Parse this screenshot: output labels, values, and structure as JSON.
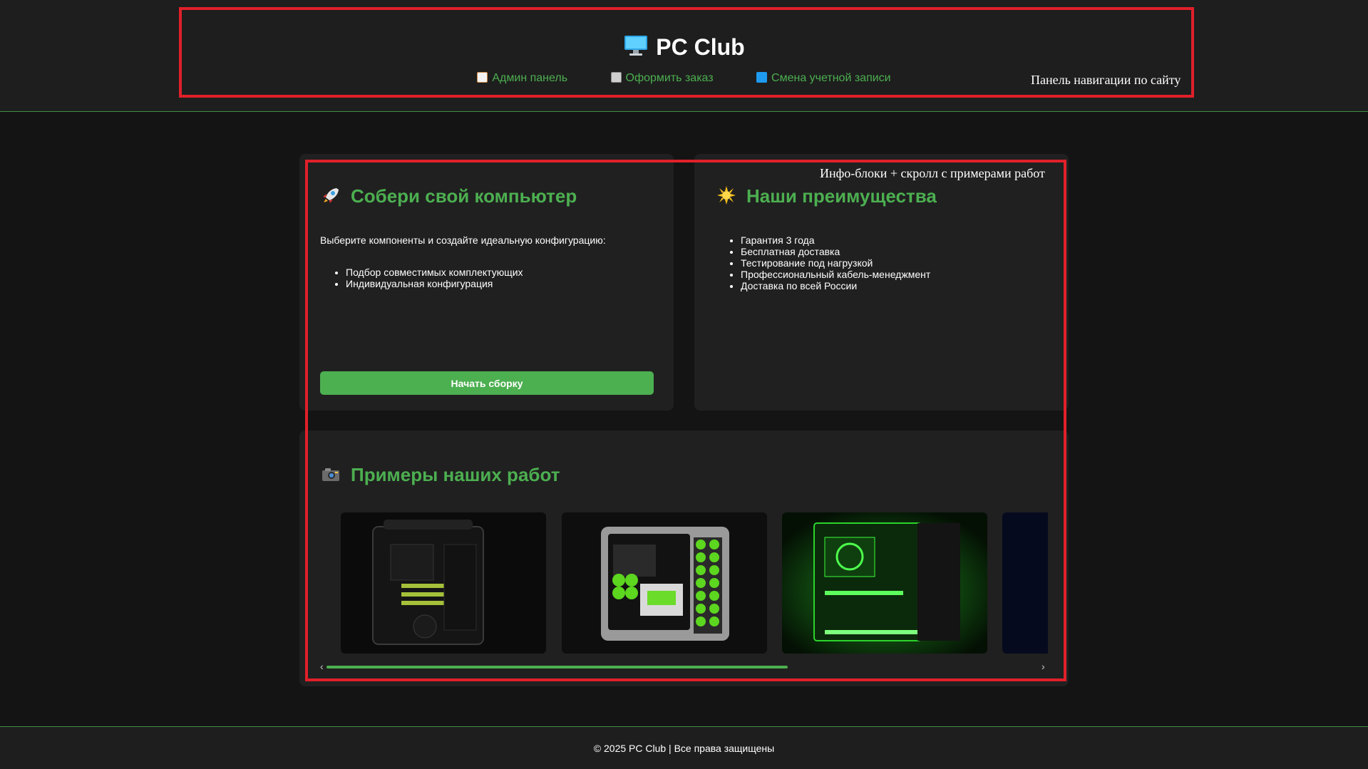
{
  "header": {
    "title": "PC Club",
    "title_icon": "desktop-computer-icon",
    "nav": [
      {
        "label": "Админ панель",
        "icon": "memo-icon"
      },
      {
        "label": "Оформить заказ",
        "icon": "cart-icon"
      },
      {
        "label": "Смена учетной записи",
        "icon": "swap-arrows-icon"
      }
    ]
  },
  "annotations": {
    "nav_label": "Панель навигации по сайту",
    "content_label": "Инфо-блоки + скролл с примерами работ",
    "color": "#e0202a"
  },
  "build_card": {
    "title": "Собери свой компьютер",
    "icon": "rocket-icon",
    "intro": "Выберите компоненты и создайте идеальную конфигурацию:",
    "items": [
      "Подбор совместимых комплектующих",
      "Индивидуальная конфигурация"
    ],
    "button": "Начать сборку"
  },
  "advantages_card": {
    "title": "Наши преимущества",
    "icon": "sun-icon",
    "items": [
      "Гарантия 3 года",
      "Бесплатная доставка",
      "Тестирование под нагрузкой",
      "Профессиональный кабель-менеджмент",
      "Доставка по всей России"
    ]
  },
  "gallery": {
    "title": "Примеры наших работ",
    "icon": "camera-icon",
    "images": [
      "pc-case-dark-image",
      "pc-case-green-hex-image",
      "pc-case-green-glow-image",
      "pc-case-blue-image"
    ]
  },
  "footer": {
    "text": "© 2025 PC Club | Все права защищены"
  },
  "colors": {
    "accent": "#4caf50",
    "background": "#141414",
    "panel": "#1e1e1e",
    "card": "#202020"
  }
}
